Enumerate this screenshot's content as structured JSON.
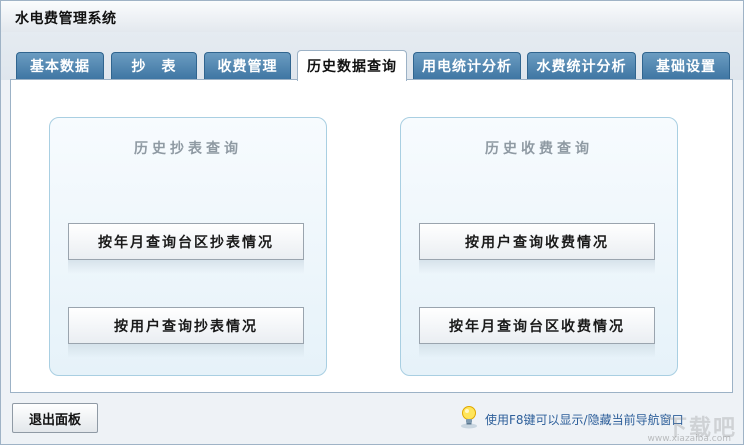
{
  "window": {
    "title": "水电费管理系统"
  },
  "tabs": [
    {
      "label": "基本数据",
      "active": false
    },
    {
      "label": "抄　表",
      "active": false
    },
    {
      "label": "收费管理",
      "active": false
    },
    {
      "label": "历史数据查询",
      "active": true
    },
    {
      "label": "用电统计分析",
      "active": false
    },
    {
      "label": "水费统计分析",
      "active": false
    },
    {
      "label": "基础设置",
      "active": false
    }
  ],
  "groups": {
    "meter_history": {
      "title": "历史抄表查询",
      "buttons": [
        "按年月查询台区抄表情况",
        "按用户查询抄表情况"
      ]
    },
    "fee_history": {
      "title": "历史收费查询",
      "buttons": [
        "按用户查询收费情况",
        "按年月查询台区收费情况"
      ]
    }
  },
  "footer": {
    "exit_label": "退出面板",
    "hint": "使用F8键可以显示/隐藏当前导航窗口"
  },
  "watermark": {
    "text": "下载吧",
    "sub": "www.xiazaiba.com"
  }
}
